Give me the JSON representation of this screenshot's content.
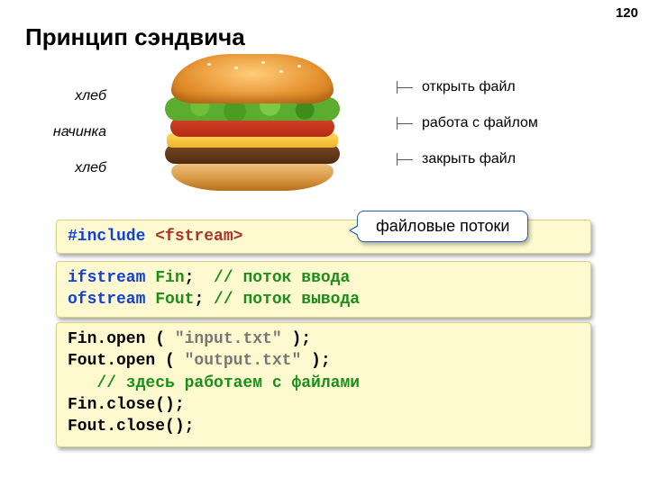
{
  "page_number": "120",
  "title": "Принцип сэндвича",
  "sandwich": {
    "left_labels": [
      "хлеб",
      "начинка",
      "хлеб"
    ],
    "right_labels": [
      "открыть файл",
      "работа с  файлом",
      "закрыть файл"
    ]
  },
  "callout": "файловые потоки",
  "code1": {
    "include_kw": "#include ",
    "include_hdr": "<fstream>"
  },
  "code2": {
    "l1_k": "ifstream",
    "l1_v": " Fin",
    "l1_r": ";  ",
    "l1_c": "// поток ввода",
    "l2_k": "ofstream",
    "l2_v": " Fout",
    "l2_r": "; ",
    "l2_c": "// поток вывода"
  },
  "code3": {
    "l1_a": "Fin.open ( ",
    "l1_s": "\"input.txt\"",
    "l1_b": " );",
    "l2_a": "Fout.open ( ",
    "l2_s": "\"output.txt\"",
    "l2_b": " );",
    "l3": "   // здесь работаем с файлами",
    "l4": "Fin.close();",
    "l5": "Fout.close();"
  }
}
